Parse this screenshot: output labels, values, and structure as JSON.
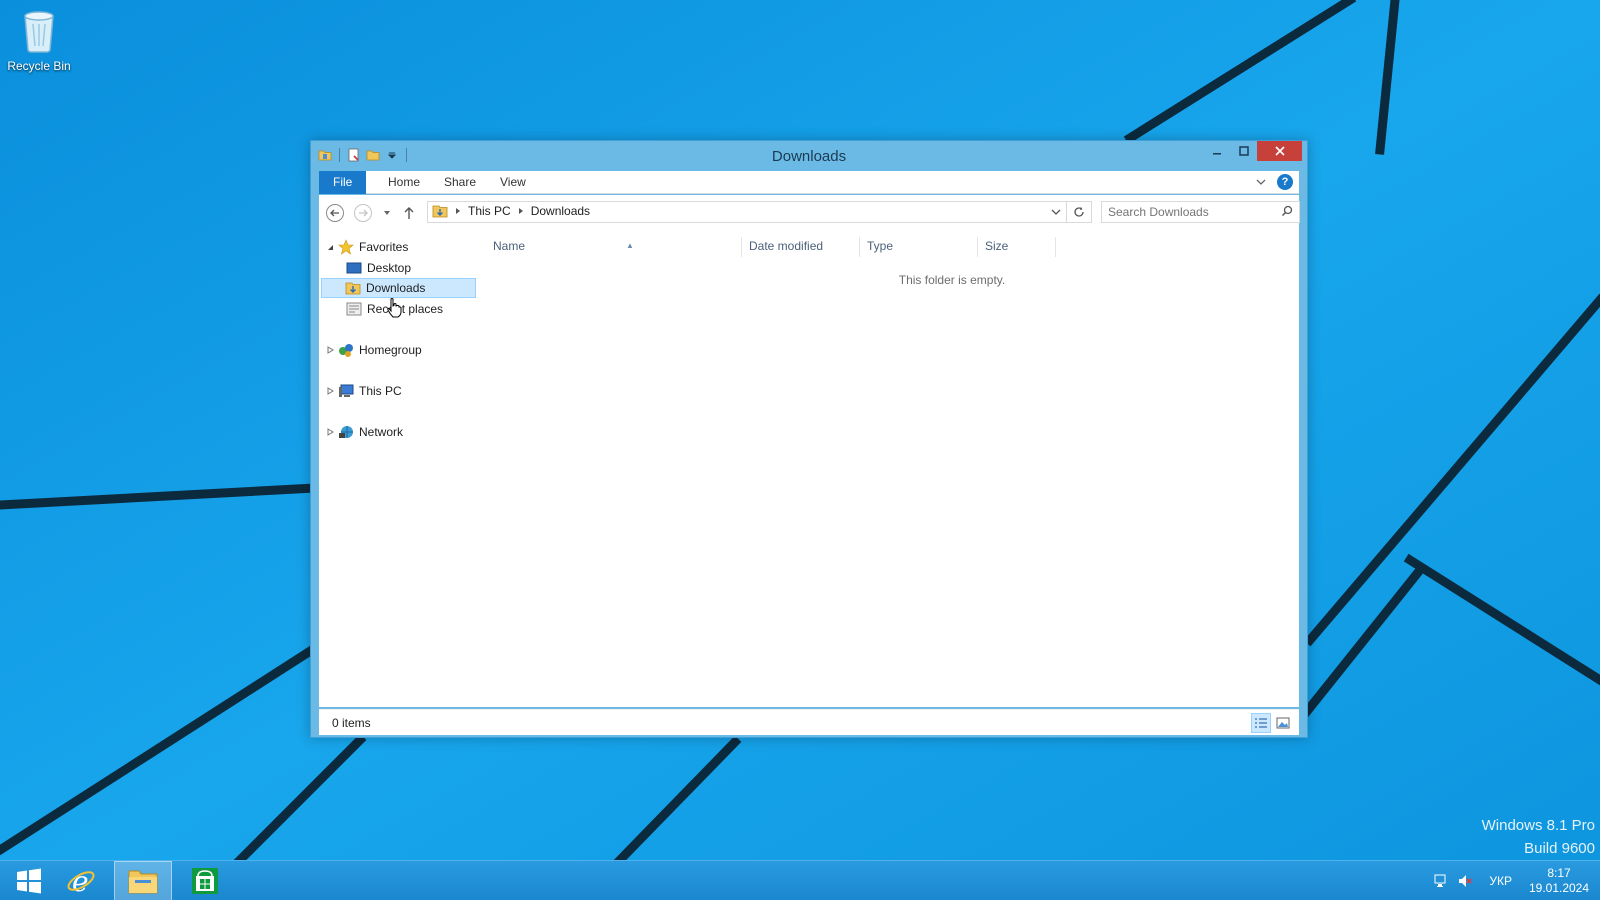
{
  "desktop": {
    "recycle_bin_label": "Recycle Bin",
    "watermark_line1": "Windows 8.1 Pro",
    "watermark_line2": "Build 9600"
  },
  "window": {
    "title": "Downloads",
    "tabs": {
      "file": "File",
      "home": "Home",
      "share": "Share",
      "view": "View"
    },
    "breadcrumb": [
      "This PC",
      "Downloads"
    ],
    "search_placeholder": "Search Downloads",
    "nav": {
      "favorites": "Favorites",
      "desktop": "Desktop",
      "downloads": "Downloads",
      "recent_places": "Recent places",
      "homegroup": "Homegroup",
      "this_pc": "This PC",
      "network": "Network"
    },
    "columns": {
      "name": "Name",
      "date_modified": "Date modified",
      "type": "Type",
      "size": "Size"
    },
    "empty_message": "This folder is empty.",
    "status_count": "0 items"
  },
  "taskbar": {
    "language": "УКР",
    "time": "8:17",
    "date": "19.01.2024",
    "pinned": [
      "start-icon",
      "internet-explorer-icon",
      "file-explorer-icon",
      "store-icon"
    ]
  },
  "colors": {
    "accent": "#1979ca",
    "window_frame": "#6bbae6",
    "close_button": "#c7403a",
    "selection": "#cce8ff",
    "taskbar": "#1c8fd6"
  }
}
